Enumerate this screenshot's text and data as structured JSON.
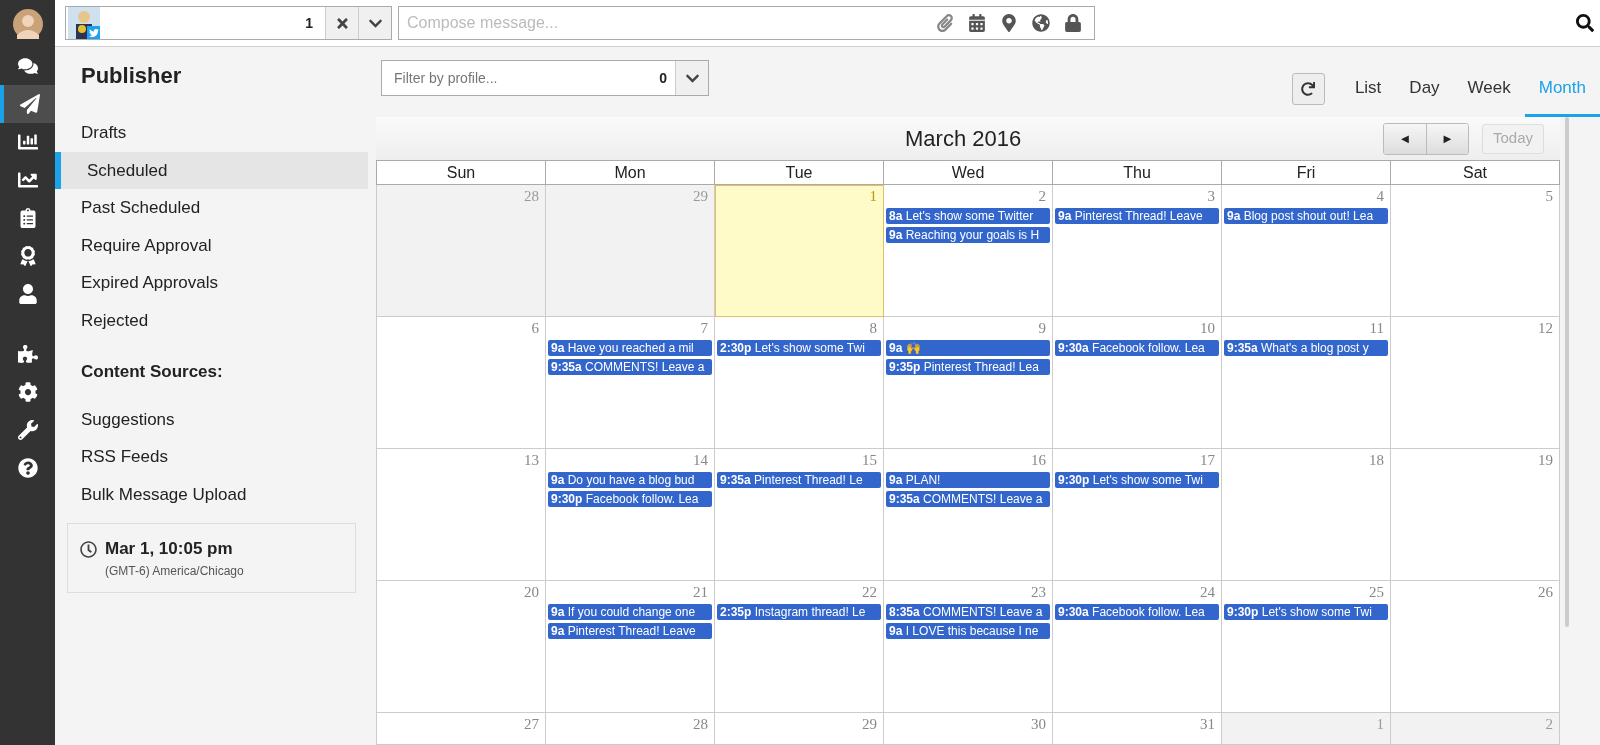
{
  "nav_rail": [
    {
      "selected": false
    },
    {
      "selected": true
    },
    {
      "selected": false
    },
    {
      "selected": false
    },
    {
      "selected": false
    },
    {
      "selected": false
    },
    {
      "selected": false
    },
    {
      "selected": false
    },
    {
      "selected": false
    },
    {
      "selected": false
    },
    {
      "selected": false
    }
  ],
  "profile_picker": {
    "count": "1"
  },
  "compose": {
    "placeholder": "Compose message..."
  },
  "sidebar": {
    "title": "Publisher",
    "items": [
      {
        "label": "Drafts",
        "selected": false
      },
      {
        "label": "Scheduled",
        "selected": true
      },
      {
        "label": "Past Scheduled",
        "selected": false
      },
      {
        "label": "Require Approval",
        "selected": false
      },
      {
        "label": "Expired Approvals",
        "selected": false
      },
      {
        "label": "Rejected",
        "selected": false
      }
    ],
    "section_title": "Content Sources:",
    "sources": [
      {
        "label": "Suggestions",
        "selected": false
      },
      {
        "label": "RSS Feeds",
        "selected": false
      },
      {
        "label": "Bulk Message Upload",
        "selected": false
      }
    ],
    "clock": {
      "time": "Mar 1, 10:05 pm",
      "zone": "(GMT-6) America/Chicago"
    }
  },
  "filter": {
    "placeholder": "Filter by profile...",
    "count": "0"
  },
  "views": [
    {
      "label": "List",
      "selected": false
    },
    {
      "label": "Day",
      "selected": false
    },
    {
      "label": "Week",
      "selected": false
    },
    {
      "label": "Month",
      "selected": true
    }
  ],
  "calendar": {
    "title": "March 2016",
    "prev": "◄",
    "next": "►",
    "today_button": {
      "label": "Today",
      "disabled": true
    },
    "weekdays": [
      "Sun",
      "Mon",
      "Tue",
      "Wed",
      "Thu",
      "Fri",
      "Sat"
    ],
    "weeks": [
      [
        {
          "day": "28",
          "kind": "other_month"
        },
        {
          "day": "29",
          "kind": "other_month"
        },
        {
          "day": "1",
          "kind": "today"
        },
        {
          "day": "2",
          "kind": "current",
          "events": [
            {
              "time": "8a",
              "text": "Let's show some Twitter"
            },
            {
              "time": "9a",
              "text": "Reaching your goals is H"
            }
          ]
        },
        {
          "day": "3",
          "kind": "current",
          "events": [
            {
              "time": "9a",
              "text": "Pinterest Thread! Leave"
            }
          ]
        },
        {
          "day": "4",
          "kind": "current",
          "events": [
            {
              "time": "9a",
              "text": "Blog post shout out! Lea"
            }
          ]
        },
        {
          "day": "5",
          "kind": "current"
        }
      ],
      [
        {
          "day": "6",
          "kind": "current"
        },
        {
          "day": "7",
          "kind": "current",
          "events": [
            {
              "time": "9a",
              "text": "Have you reached a mil"
            },
            {
              "time": "9:35a",
              "text": "COMMENTS! Leave a"
            }
          ]
        },
        {
          "day": "8",
          "kind": "current",
          "events": [
            {
              "time": "2:30p",
              "text": "Let's show some Twi"
            }
          ]
        },
        {
          "day": "9",
          "kind": "current",
          "events": [
            {
              "time": "9a",
              "text": "🙌"
            },
            {
              "time": "9:35p",
              "text": "Pinterest Thread! Lea"
            }
          ]
        },
        {
          "day": "10",
          "kind": "current",
          "events": [
            {
              "time": "9:30a",
              "text": "Facebook follow. Lea"
            }
          ]
        },
        {
          "day": "11",
          "kind": "current",
          "events": [
            {
              "time": "9:35a",
              "text": "What's a blog post y"
            }
          ]
        },
        {
          "day": "12",
          "kind": "current"
        }
      ],
      [
        {
          "day": "13",
          "kind": "current"
        },
        {
          "day": "14",
          "kind": "current",
          "events": [
            {
              "time": "9a",
              "text": "Do you have a blog bud"
            },
            {
              "time": "9:30p",
              "text": "Facebook follow. Lea"
            }
          ]
        },
        {
          "day": "15",
          "kind": "current",
          "events": [
            {
              "time": "9:35a",
              "text": "Pinterest Thread! Le"
            }
          ]
        },
        {
          "day": "16",
          "kind": "current",
          "events": [
            {
              "time": "9a",
              "text": "PLAN!"
            },
            {
              "time": "9:35a",
              "text": "COMMENTS! Leave a"
            }
          ]
        },
        {
          "day": "17",
          "kind": "current",
          "events": [
            {
              "time": "9:30p",
              "text": "Let's show some Twi"
            }
          ]
        },
        {
          "day": "18",
          "kind": "current"
        },
        {
          "day": "19",
          "kind": "current"
        }
      ],
      [
        {
          "day": "20",
          "kind": "current"
        },
        {
          "day": "21",
          "kind": "current",
          "events": [
            {
              "time": "9a",
              "text": "If you could change one"
            },
            {
              "time": "9a",
              "text": "Pinterest Thread! Leave"
            }
          ]
        },
        {
          "day": "22",
          "kind": "current",
          "events": [
            {
              "time": "2:35p",
              "text": "Instagram thread! Le"
            }
          ]
        },
        {
          "day": "23",
          "kind": "current",
          "events": [
            {
              "time": "8:35a",
              "text": "COMMENTS! Leave a"
            },
            {
              "time": "9a",
              "text": "I LOVE this because I ne"
            }
          ]
        },
        {
          "day": "24",
          "kind": "current",
          "events": [
            {
              "time": "9:30a",
              "text": "Facebook follow. Lea"
            }
          ]
        },
        {
          "day": "25",
          "kind": "current",
          "events": [
            {
              "time": "9:30p",
              "text": "Let's show some Twi"
            }
          ]
        },
        {
          "day": "26",
          "kind": "current"
        }
      ],
      [
        {
          "day": "27",
          "kind": "current"
        },
        {
          "day": "28",
          "kind": "current"
        },
        {
          "day": "29",
          "kind": "current"
        },
        {
          "day": "30",
          "kind": "current"
        },
        {
          "day": "31",
          "kind": "current"
        },
        {
          "day": "1",
          "kind": "other_month"
        },
        {
          "day": "2",
          "kind": "other_month"
        }
      ]
    ]
  }
}
